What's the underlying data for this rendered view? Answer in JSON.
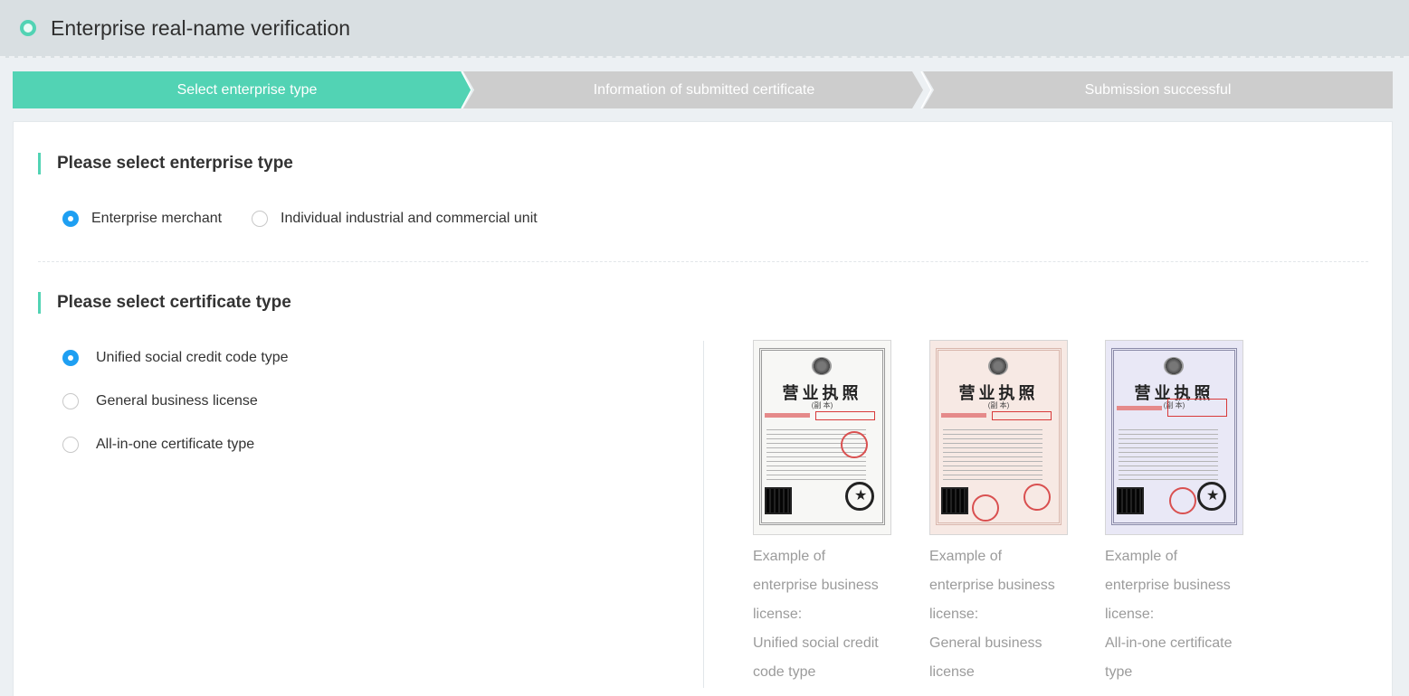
{
  "header": {
    "title": "Enterprise real-name verification",
    "icon": "status-dot-icon",
    "accent": "#52d3b4"
  },
  "steps": [
    {
      "label": "Select enterprise type",
      "active": true
    },
    {
      "label": "Information of submitted certificate",
      "active": false
    },
    {
      "label": "Submission successful",
      "active": false
    }
  ],
  "enterprise_type": {
    "title": "Please select enterprise type",
    "options": [
      {
        "label": "Enterprise merchant",
        "selected": true
      },
      {
        "label": "Individual industrial and commercial unit",
        "selected": false
      }
    ]
  },
  "certificate_type": {
    "title": "Please select certificate type",
    "options": [
      {
        "label": "Unified social credit code type",
        "selected": true
      },
      {
        "label": "General business license",
        "selected": false
      },
      {
        "label": "All-in-one certificate type",
        "selected": false
      }
    ]
  },
  "examples": [
    {
      "caption": "Example of enterprise business license:",
      "type": "Unified social credit code type",
      "doc_title": "营业执照",
      "doc_subtitle": "(副 本)"
    },
    {
      "caption": "Example of enterprise business license:",
      "type": "General business license",
      "doc_title": "营业执照",
      "doc_subtitle": "(副 本)"
    },
    {
      "caption": "Example of enterprise business license:",
      "type": "All-in-one certificate type",
      "doc_title": "营业执照",
      "doc_subtitle": "(副 本)"
    }
  ],
  "colors": {
    "accent": "#52d3b4",
    "radio_selected": "#1e9ff2",
    "step_inactive": "#cdcdcd"
  }
}
